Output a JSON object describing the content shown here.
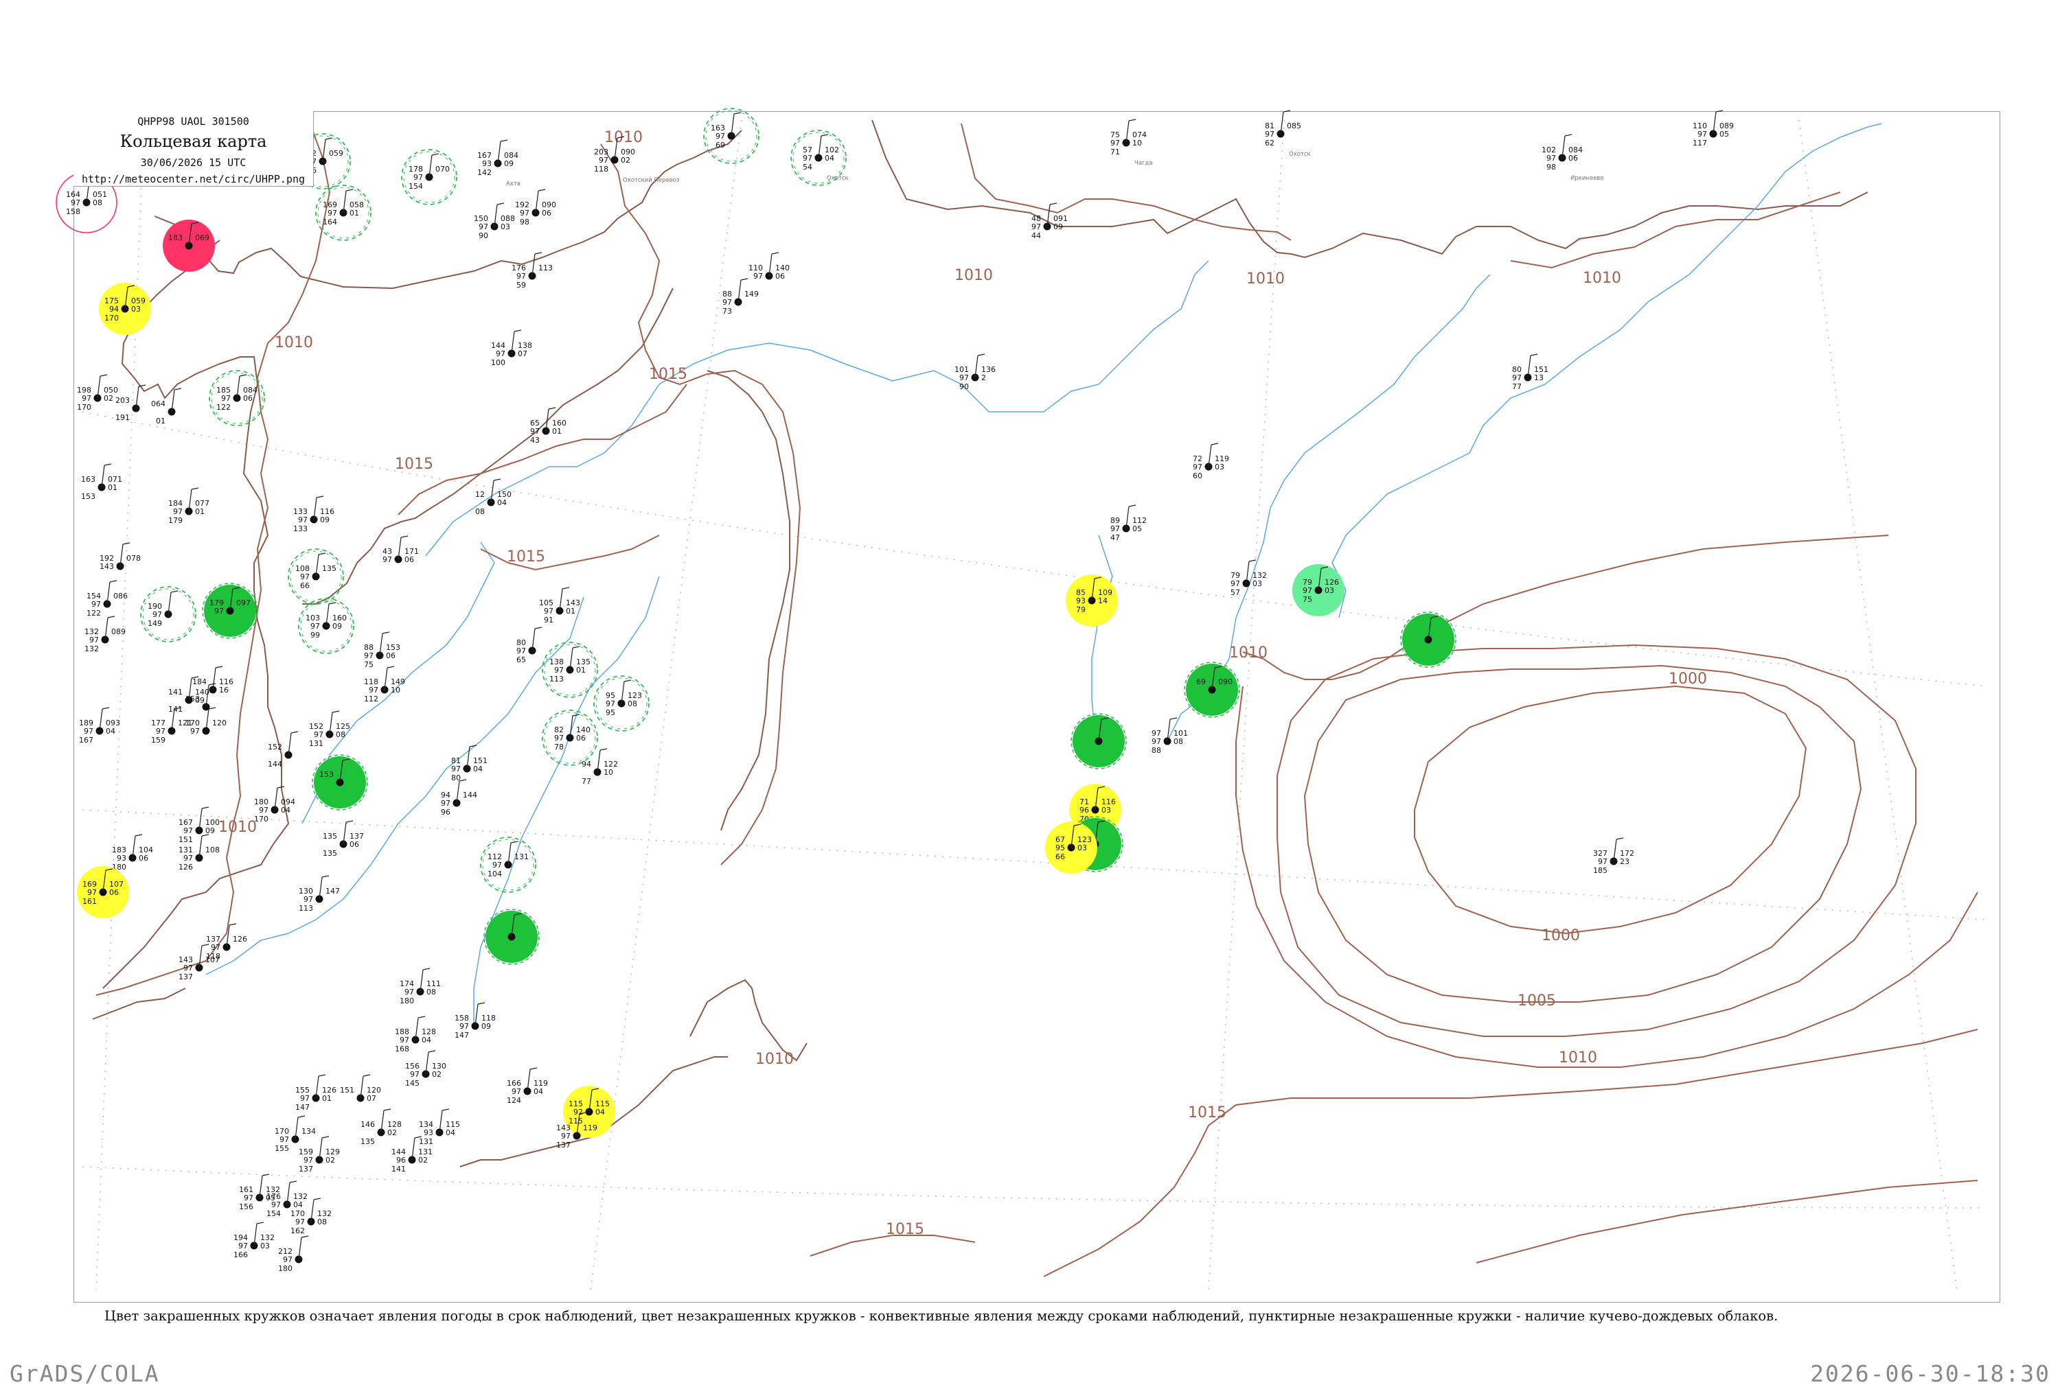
{
  "header": {
    "code": "QHPP98  UAOL  301500",
    "title": "Кольцевая карта",
    "valid_time": "30/06/2026 15 UTC",
    "url": "http://meteocenter.net/circ/UHPP.png"
  },
  "legend_note": "Цвет закрашенных кружков означает явления погоды в срок наблюдений, цвет незакрашенных кружков - конвективные явления между сроками наблюдений, пунктирные незакрашенные кружки - наличие кучево-дождевых облаков.",
  "footer": {
    "software": "GrADS/COLA",
    "timestamp": "2026-06-30-18:30"
  },
  "isobar_labels": [
    "1010",
    "1010",
    "1015",
    "1015",
    "1010",
    "1010",
    "1010",
    "1015",
    "1010",
    "1010",
    "1000",
    "1000",
    "1005",
    "1010",
    "1015",
    "1015",
    "1010",
    "1010"
  ],
  "colors": {
    "isobar": "#a0614f",
    "coast": "#8a5a4a",
    "river": "#5aa8e6",
    "green_fill": "#1ec23a",
    "yellow_fill": "#ffff33",
    "red_fill": "#ff3366",
    "light_green_fill": "#66ee99",
    "cb_dash": "#33bb55",
    "frame": "#9a9a9a"
  },
  "stations": [
    {
      "t": "164",
      "d": "97",
      "p": "158",
      "pp": "051",
      "pt": "08",
      "name": "",
      "kind": "red-ring"
    },
    {
      "t": "172",
      "d": "97",
      "p": "156",
      "pp": "059",
      "pt": "",
      "name": "",
      "kind": "cb"
    },
    {
      "t": "169",
      "d": "97",
      "p": "164",
      "pp": "058",
      "pt": "01",
      "name": "",
      "kind": "cb"
    },
    {
      "t": "178",
      "d": "97",
      "p": "154",
      "pp": "070",
      "pt": "",
      "name": "",
      "kind": "cb"
    },
    {
      "t": "167",
      "d": "93",
      "p": "142",
      "pp": "084",
      "pt": "09",
      "name": "Ахта",
      "kind": "plain"
    },
    {
      "t": "203",
      "d": "97",
      "p": "118",
      "pp": "090",
      "pt": "02",
      "name": "Охотский Перевоз",
      "kind": "plain"
    },
    {
      "t": "163",
      "d": "97",
      "p": "69",
      "pp": "",
      "pt": "",
      "name": "",
      "kind": "cb"
    },
    {
      "t": "57",
      "d": "97",
      "p": "54",
      "pp": "102",
      "pt": "04",
      "name": "Охотск",
      "kind": "cb"
    },
    {
      "t": "75",
      "d": "97",
      "p": "71",
      "pp": "074",
      "pt": "10",
      "name": "Чагда",
      "kind": "plain"
    },
    {
      "t": "81",
      "d": "97",
      "p": "62",
      "pp": "085",
      "pt": "",
      "name": "Охотск",
      "kind": "plain"
    },
    {
      "t": "102",
      "d": "97",
      "p": "98",
      "pp": "084",
      "pt": "06",
      "name": "Иркинеево",
      "kind": "plain"
    },
    {
      "t": "110",
      "d": "97",
      "p": "117",
      "pp": "089",
      "pt": "05",
      "name": "",
      "kind": "plain"
    },
    {
      "t": "183",
      "d": "",
      "p": "",
      "pp": "069",
      "pt": "",
      "name": "",
      "kind": "red"
    },
    {
      "t": "175",
      "d": "94",
      "p": "170",
      "pp": "059",
      "pt": "03",
      "name": "",
      "kind": "yellow"
    },
    {
      "t": "150",
      "d": "97",
      "p": "90",
      "pp": "088",
      "pt": "03",
      "name": "",
      "kind": "plain"
    },
    {
      "t": "192",
      "d": "97",
      "p": "98",
      "pp": "090",
      "pt": "06",
      "name": "",
      "kind": "plain"
    },
    {
      "t": "176",
      "d": "97",
      "p": "59",
      "pp": "113",
      "pt": "",
      "name": "",
      "kind": "plain"
    },
    {
      "t": "48",
      "d": "97",
      "p": "44",
      "pp": "091",
      "pt": "09",
      "name": "",
      "kind": "plain"
    },
    {
      "t": "110",
      "d": "97",
      "p": "",
      "pp": "140",
      "pt": "06",
      "name": "",
      "kind": "plain"
    },
    {
      "t": "88",
      "d": "97",
      "p": "73",
      "pp": "149",
      "pt": "",
      "name": "",
      "kind": "plain"
    },
    {
      "t": "198",
      "d": "97",
      "p": "170",
      "pp": "050",
      "pt": "02",
      "name": "",
      "kind": "plain"
    },
    {
      "t": "203",
      "d": "",
      "p": "191",
      "pp": "",
      "pt": "",
      "name": "",
      "kind": "plain"
    },
    {
      "t": "064",
      "d": "",
      "p": "01",
      "pp": "",
      "pt": "",
      "name": "",
      "kind": "plain"
    },
    {
      "t": "185",
      "d": "97",
      "p": "122",
      "pp": "084",
      "pt": "06",
      "name": "",
      "kind": "cb"
    },
    {
      "t": "144",
      "d": "97",
      "p": "100",
      "pp": "138",
      "pt": "07",
      "name": "",
      "kind": "plain"
    },
    {
      "t": "101",
      "d": "97",
      "p": "90",
      "pp": "136",
      "pt": "2",
      "name": "",
      "kind": "plain"
    },
    {
      "t": "80",
      "d": "97",
      "p": "77",
      "pp": "151",
      "pt": "13",
      "name": "",
      "kind": "plain"
    },
    {
      "t": "65",
      "d": "97",
      "p": "43",
      "pp": "160",
      "pt": "01",
      "name": "",
      "kind": "plain"
    },
    {
      "t": "163",
      "d": "",
      "p": "153",
      "pp": "071",
      "pt": "01",
      "name": "",
      "kind": "plain"
    },
    {
      "t": "184",
      "d": "97",
      "p": "179",
      "pp": "077",
      "pt": "01",
      "name": "",
      "kind": "plain"
    },
    {
      "t": "12",
      "d": "",
      "p": "08",
      "pp": "150",
      "pt": "04",
      "name": "",
      "kind": "plain"
    },
    {
      "t": "72",
      "d": "97",
      "p": "60",
      "pp": "119",
      "pt": "03",
      "name": "",
      "kind": "plain"
    },
    {
      "t": "133",
      "d": "97",
      "p": "133",
      "pp": "116",
      "pt": "09",
      "name": "",
      "kind": "plain"
    },
    {
      "t": "43",
      "d": "97",
      "p": "",
      "pp": "171",
      "pt": "06",
      "name": "",
      "kind": "plain"
    },
    {
      "t": "89",
      "d": "97",
      "p": "47",
      "pp": "112",
      "pt": "05",
      "name": "",
      "kind": "plain"
    },
    {
      "t": "192",
      "d": "143",
      "p": "",
      "pp": "078",
      "pt": "",
      "name": "",
      "kind": "plain"
    },
    {
      "t": "108",
      "d": "97",
      "p": "66",
      "pp": "135",
      "pt": "",
      "name": "",
      "kind": "cb"
    },
    {
      "t": "79",
      "d": "97",
      "p": "57",
      "pp": "132",
      "pt": "03",
      "name": "",
      "kind": "plain"
    },
    {
      "t": "79",
      "d": "97",
      "p": "75",
      "pp": "126",
      "pt": "03",
      "name": "",
      "kind": "light-green"
    },
    {
      "t": "154",
      "d": "97",
      "p": "122",
      "pp": "086",
      "pt": "",
      "name": "",
      "kind": "plain"
    },
    {
      "t": "190",
      "d": "97",
      "p": "149",
      "pp": "",
      "pt": "",
      "name": "",
      "kind": "cb"
    },
    {
      "t": "179",
      "d": "97",
      "p": "",
      "pp": "097",
      "pt": "",
      "name": "",
      "kind": "green"
    },
    {
      "t": "85",
      "d": "93",
      "p": "79",
      "pp": "109",
      "pt": "14",
      "name": "",
      "kind": "yellow"
    },
    {
      "t": "103",
      "d": "97",
      "p": "99",
      "pp": "160",
      "pt": "09",
      "name": "",
      "kind": "cb"
    },
    {
      "t": "105",
      "d": "97",
      "p": "91",
      "pp": "143",
      "pt": "01",
      "name": "",
      "kind": "plain"
    },
    {
      "t": "132",
      "d": "97",
      "p": "132",
      "pp": "089",
      "pt": "",
      "name": "",
      "kind": "plain"
    },
    {
      "t": "88",
      "d": "97",
      "p": "75",
      "pp": "153",
      "pt": "06",
      "name": "",
      "kind": "plain"
    },
    {
      "t": "80",
      "d": "97",
      "p": "65",
      "pp": "",
      "pt": "",
      "name": "",
      "kind": "plain"
    },
    {
      "t": "138",
      "d": "97",
      "p": "113",
      "pp": "135",
      "pt": "01",
      "name": "",
      "kind": "cb"
    },
    {
      "t": "",
      "d": "",
      "p": "",
      "pp": "",
      "pt": "",
      "name": "",
      "kind": "green"
    },
    {
      "t": "69",
      "d": "",
      "p": "",
      "pp": "090",
      "pt": "",
      "name": "",
      "kind": "green"
    },
    {
      "t": "95",
      "d": "97",
      "p": "95",
      "pp": "123",
      "pt": "08",
      "name": "",
      "kind": "cb"
    },
    {
      "t": "118",
      "d": "97",
      "p": "112",
      "pp": "149",
      "pt": "10",
      "name": "",
      "kind": "plain"
    },
    {
      "t": "184",
      "d": "",
      "p": "",
      "pp": "116",
      "pt": "16",
      "name": "",
      "kind": "plain"
    },
    {
      "t": "141",
      "d": "",
      "p": "141",
      "pp": "140",
      "pt": "09",
      "name": "",
      "kind": "plain"
    },
    {
      "t": "153",
      "d": "",
      "p": "",
      "pp": "",
      "pt": "",
      "name": "",
      "kind": "plain"
    },
    {
      "t": "177",
      "d": "97",
      "p": "159",
      "pp": "121",
      "pt": "",
      "name": "",
      "kind": "plain"
    },
    {
      "t": "170",
      "d": "97",
      "p": "",
      "pp": "120",
      "pt": "",
      "name": "",
      "kind": "plain"
    },
    {
      "t": "189",
      "d": "97",
      "p": "167",
      "pp": "093",
      "pt": "04",
      "name": "",
      "kind": "plain"
    },
    {
      "t": "152",
      "d": "97",
      "p": "131",
      "pp": "125",
      "pt": "08",
      "name": "",
      "kind": "plain"
    },
    {
      "t": "82",
      "d": "97",
      "p": "78",
      "pp": "140",
      "pt": "06",
      "name": "",
      "kind": "cb"
    },
    {
      "t": "97",
      "d": "97",
      "p": "88",
      "pp": "101",
      "pt": "08",
      "name": "",
      "kind": "plain"
    },
    {
      "t": "",
      "d": "",
      "p": "",
      "pp": "",
      "pt": "",
      "name": "",
      "kind": "green"
    },
    {
      "t": "152",
      "d": "",
      "p": "144",
      "pp": "",
      "pt": "",
      "name": "",
      "kind": "plain"
    },
    {
      "t": "153",
      "d": "",
      "p": "",
      "pp": "",
      "pt": "",
      "name": "",
      "kind": "green"
    },
    {
      "t": "81",
      "d": "97",
      "p": "80",
      "pp": "151",
      "pt": "04",
      "name": "",
      "kind": "plain"
    },
    {
      "t": "94",
      "d": "",
      "p": "77",
      "pp": "122",
      "pt": "10",
      "name": "",
      "kind": "plain"
    },
    {
      "t": "94",
      "d": "97",
      "p": "96",
      "pp": "144",
      "pt": "",
      "name": "",
      "kind": "plain"
    },
    {
      "t": "180",
      "d": "97",
      "p": "170",
      "pp": "094",
      "pt": "04",
      "name": "",
      "kind": "plain"
    },
    {
      "t": "71",
      "d": "96",
      "p": "70",
      "pp": "116",
      "pt": "03",
      "name": "",
      "kind": "yellow"
    },
    {
      "t": "",
      "d": "",
      "p": "",
      "pp": "",
      "pt": "",
      "name": "",
      "kind": "green"
    },
    {
      "t": "167",
      "d": "97",
      "p": "151",
      "pp": "100",
      "pt": "09",
      "name": "",
      "kind": "plain"
    },
    {
      "t": "67",
      "d": "95",
      "p": "66",
      "pp": "123",
      "pt": "03",
      "name": "",
      "kind": "yellow"
    },
    {
      "t": "183",
      "d": "93",
      "p": "180",
      "pp": "104",
      "pt": "06",
      "name": "",
      "kind": "plain"
    },
    {
      "t": "135",
      "d": "",
      "p": "135",
      "pp": "137",
      "pt": "06",
      "name": "",
      "kind": "plain"
    },
    {
      "t": "131",
      "d": "97",
      "p": "126",
      "pp": "108",
      "pt": "",
      "name": "",
      "kind": "plain"
    },
    {
      "t": "112",
      "d": "97",
      "p": "104",
      "pp": "131",
      "pt": "",
      "name": "",
      "kind": "cb"
    },
    {
      "t": "327",
      "d": "97",
      "p": "185",
      "pp": "172",
      "pt": "23",
      "name": "",
      "kind": "plain"
    },
    {
      "t": "169",
      "d": "97",
      "p": "161",
      "pp": "107",
      "pt": "06",
      "name": "",
      "kind": "yellow"
    },
    {
      "t": "130",
      "d": "97",
      "p": "113",
      "pp": "147",
      "pt": "",
      "name": "",
      "kind": "plain"
    },
    {
      "t": "",
      "d": "",
      "p": "",
      "pp": "",
      "pt": "",
      "name": "",
      "kind": "green"
    },
    {
      "t": "137",
      "d": "97",
      "p": "118",
      "pp": "126",
      "pt": "",
      "name": "",
      "kind": "plain"
    },
    {
      "t": "143",
      "d": "97",
      "p": "137",
      "pp": "107",
      "pt": "",
      "name": "",
      "kind": "plain"
    },
    {
      "t": "174",
      "d": "97",
      "p": "180",
      "pp": "111",
      "pt": "08",
      "name": "",
      "kind": "plain"
    },
    {
      "t": "158",
      "d": "97",
      "p": "147",
      "pp": "118",
      "pt": "09",
      "name": "",
      "kind": "plain"
    },
    {
      "t": "188",
      "d": "97",
      "p": "168",
      "pp": "128",
      "pt": "04",
      "name": "",
      "kind": "plain"
    },
    {
      "t": "156",
      "d": "97",
      "p": "145",
      "pp": "130",
      "pt": "02",
      "name": "",
      "kind": "plain"
    },
    {
      "t": "166",
      "d": "97",
      "p": "124",
      "pp": "119",
      "pt": "04",
      "name": "",
      "kind": "plain"
    },
    {
      "t": "115",
      "d": "92",
      "p": "115",
      "pp": "115",
      "pt": "04",
      "name": "",
      "kind": "yellow"
    },
    {
      "t": "155",
      "d": "97",
      "p": "147",
      "pp": "126",
      "pt": "01",
      "name": "",
      "kind": "plain"
    },
    {
      "t": "151",
      "d": "",
      "p": "",
      "pp": "120",
      "pt": "07",
      "name": "",
      "kind": "plain"
    },
    {
      "t": "146",
      "d": "",
      "p": "135",
      "pp": "128",
      "pt": "02",
      "name": "",
      "kind": "plain"
    },
    {
      "t": "134",
      "d": "93",
      "p": "131",
      "pp": "115",
      "pt": "04",
      "name": "",
      "kind": "plain"
    },
    {
      "t": "143",
      "d": "97",
      "p": "137",
      "pp": "119",
      "pt": "",
      "name": "",
      "kind": "plain"
    },
    {
      "t": "170",
      "d": "97",
      "p": "155",
      "pp": "134",
      "pt": "",
      "name": "",
      "kind": "plain"
    },
    {
      "t": "159",
      "d": "97",
      "p": "137",
      "pp": "129",
      "pt": "02",
      "name": "",
      "kind": "plain"
    },
    {
      "t": "144",
      "d": "96",
      "p": "141",
      "pp": "131",
      "pt": "02",
      "name": "",
      "kind": "plain"
    },
    {
      "t": "161",
      "d": "97",
      "p": "156",
      "pp": "132",
      "pt": "05",
      "name": "",
      "kind": "plain"
    },
    {
      "t": "176",
      "d": "97",
      "p": "154",
      "pp": "132",
      "pt": "04",
      "name": "",
      "kind": "plain"
    },
    {
      "t": "170",
      "d": "97",
      "p": "162",
      "pp": "132",
      "pt": "08",
      "name": "",
      "kind": "plain"
    },
    {
      "t": "194",
      "d": "97",
      "p": "166",
      "pp": "132",
      "pt": "03",
      "name": "",
      "kind": "plain"
    },
    {
      "t": "212",
      "d": "97",
      "p": "180",
      "pp": "",
      "pt": "",
      "name": "",
      "kind": "plain"
    }
  ]
}
